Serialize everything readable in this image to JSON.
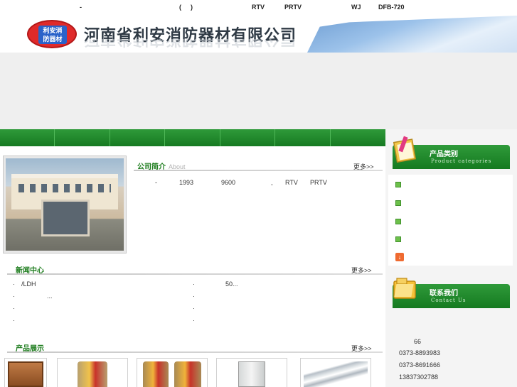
{
  "keyword_bar": {
    "items": [
      "-",
      "(",
      ")",
      "RTV",
      "PRTV",
      "WJ",
      "DFB-720"
    ]
  },
  "header": {
    "logo_text": "利安消\n防器材",
    "company_name": "河南省利安消防器材有限公司"
  },
  "about": {
    "title": "公司简介",
    "subtitle": "About",
    "more_label": "更多>>",
    "text_fragments": [
      "-",
      "1993",
      "9600",
      ",",
      "RTV",
      "PRTV"
    ]
  },
  "news": {
    "title": "新闻中心",
    "more_label": "更多>>",
    "items": [
      {
        "left": "/LDH",
        "right": "50..."
      },
      {
        "left": "...",
        "right": ""
      },
      {
        "left": "",
        "right": ""
      },
      {
        "left": "",
        "right": ""
      }
    ]
  },
  "products": {
    "title": "产品展示",
    "more_label": "更多>>"
  },
  "sidebar": {
    "categories": {
      "title": "产品类别",
      "subtitle": "Product categories"
    },
    "contact": {
      "title": "联系我们",
      "subtitle": "Contact Us",
      "lines": [
        "66",
        "0373-8893983",
        "0373-8691666",
        "13837302788"
      ]
    }
  },
  "colors": {
    "nav_green": "#1f8a2b",
    "title_green": "#1e7d1e",
    "banner_grey": "#efefef"
  }
}
